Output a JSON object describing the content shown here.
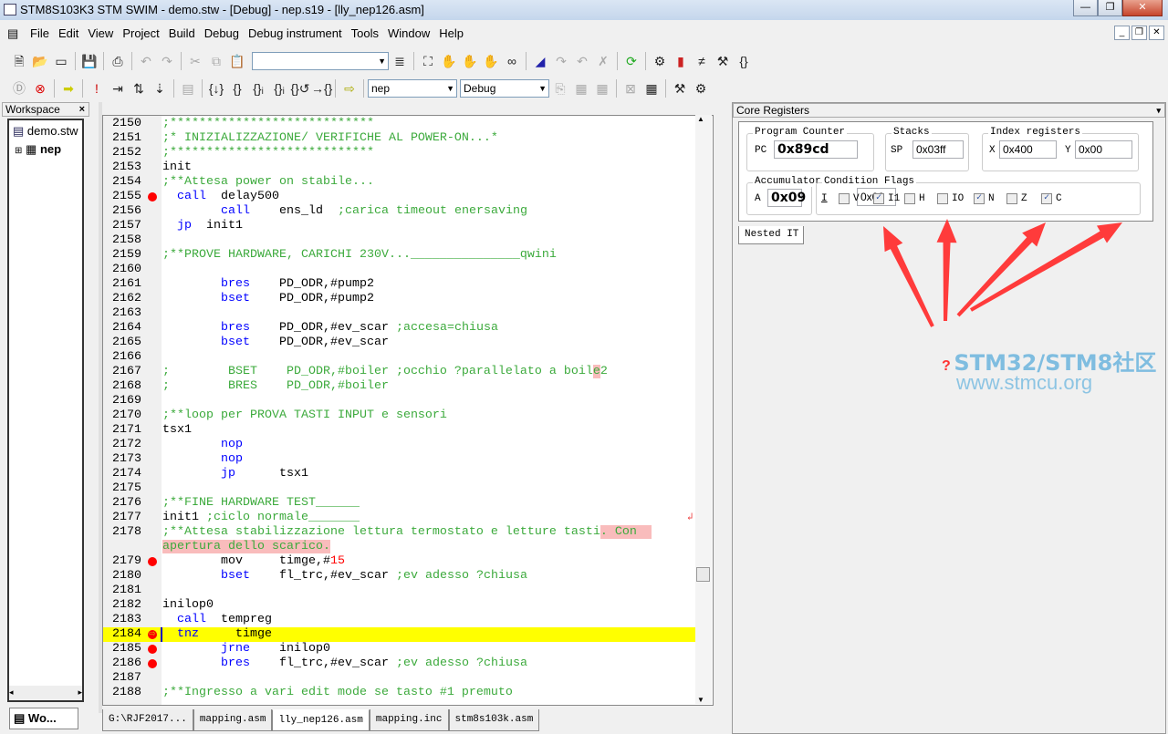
{
  "window": {
    "title": "STM8S103K3 STM SWIM - demo.stw - [Debug] - nep.s19 - [lly_nep126.asm]",
    "min": "—",
    "max": "❐",
    "close": "✕"
  },
  "menu": [
    "File",
    "Edit",
    "View",
    "Project",
    "Build",
    "Debug",
    "Debug instrument",
    "Tools",
    "Window",
    "Help"
  ],
  "toolbar1": {
    "search_value": ""
  },
  "toolbar2": {
    "project_combo": "nep",
    "config_combo": "Debug"
  },
  "workspace": {
    "title": "Workspace",
    "close": "×",
    "tree": [
      "demo.stw",
      "nep"
    ],
    "bottom_tab": "Wo..."
  },
  "editor": {
    "tabs": [
      "G:\\RJF2017...",
      "mapping.asm",
      "lly_nep126.asm",
      "mapping.inc",
      "stm8s103k.asm"
    ],
    "active_tab": 2,
    "lines": [
      {
        "n": "2150",
        "s": [
          [
            "cm",
            ";****************************"
          ]
        ]
      },
      {
        "n": "2151",
        "s": [
          [
            "cm",
            ";* INIZIALIZZAZIONE/ VERIFICHE AL POWER-ON...*"
          ]
        ]
      },
      {
        "n": "2152",
        "s": [
          [
            "cm",
            ";****************************"
          ]
        ]
      },
      {
        "n": "2153",
        "s": [
          [
            "tx",
            "init"
          ]
        ]
      },
      {
        "n": "2154",
        "s": [
          [
            "cm",
            ";**Attesa power on stabile..."
          ]
        ]
      },
      {
        "n": "2155",
        "bp": true,
        "s": [
          [
            "tx",
            "  "
          ],
          [
            "kw",
            "call"
          ],
          [
            "tx",
            "  delay500"
          ]
        ]
      },
      {
        "n": "2156",
        "s": [
          [
            "tx",
            "        "
          ],
          [
            "kw",
            "call"
          ],
          [
            "tx",
            "    ens_ld  "
          ],
          [
            "cm",
            ";carica timeout enersaving"
          ]
        ]
      },
      {
        "n": "2157",
        "s": [
          [
            "tx",
            "  "
          ],
          [
            "kw",
            "jp"
          ],
          [
            "tx",
            "  init1"
          ]
        ]
      },
      {
        "n": "2158",
        "s": []
      },
      {
        "n": "2159",
        "s": [
          [
            "cm",
            ";**PROVE HARDWARE, CARICHI 230V..._______________qwini"
          ]
        ]
      },
      {
        "n": "2160",
        "s": []
      },
      {
        "n": "2161",
        "s": [
          [
            "tx",
            "        "
          ],
          [
            "kw",
            "bres"
          ],
          [
            "tx",
            "    PD_ODR,#pump2"
          ]
        ]
      },
      {
        "n": "2162",
        "s": [
          [
            "tx",
            "        "
          ],
          [
            "kw",
            "bset"
          ],
          [
            "tx",
            "    PD_ODR,#pump2"
          ]
        ]
      },
      {
        "n": "2163",
        "s": []
      },
      {
        "n": "2164",
        "s": [
          [
            "tx",
            "        "
          ],
          [
            "kw",
            "bres"
          ],
          [
            "tx",
            "    PD_ODR,#ev_scar "
          ],
          [
            "cm",
            ";accesa=chiusa"
          ]
        ]
      },
      {
        "n": "2165",
        "s": [
          [
            "tx",
            "        "
          ],
          [
            "kw",
            "bset"
          ],
          [
            "tx",
            "    PD_ODR,#ev_scar"
          ]
        ]
      },
      {
        "n": "2166",
        "s": []
      },
      {
        "n": "2167",
        "s": [
          [
            "cm",
            ";        BSET    PD_ODR,#boiler ;occhio ?parallelato a boil"
          ],
          [
            "hl cm",
            "e"
          ],
          [
            "cm",
            "2"
          ]
        ]
      },
      {
        "n": "2168",
        "s": [
          [
            "cm",
            ";        BRES    PD_ODR,#boiler"
          ]
        ]
      },
      {
        "n": "2169",
        "s": []
      },
      {
        "n": "2170",
        "s": [
          [
            "cm",
            ";**loop per PROVA TASTI INPUT e sensori"
          ]
        ]
      },
      {
        "n": "2171",
        "s": [
          [
            "tx",
            "tsx1"
          ]
        ]
      },
      {
        "n": "2172",
        "s": [
          [
            "tx",
            "        "
          ],
          [
            "kw",
            "nop"
          ]
        ]
      },
      {
        "n": "2173",
        "s": [
          [
            "tx",
            "        "
          ],
          [
            "kw",
            "nop"
          ]
        ]
      },
      {
        "n": "2174",
        "s": [
          [
            "tx",
            "        "
          ],
          [
            "kw",
            "jp"
          ],
          [
            "tx",
            "      tsx1"
          ]
        ]
      },
      {
        "n": "2175",
        "s": []
      },
      {
        "n": "2176",
        "s": [
          [
            "cm",
            ";**FINE HARDWARE TEST______"
          ]
        ]
      },
      {
        "n": "2177",
        "s": [
          [
            "tx",
            "init1 "
          ],
          [
            "cm",
            ";ciclo normale_______"
          ]
        ]
      },
      {
        "n": "2178",
        "s": [
          [
            "cm",
            ";**Attesa stabilizzazione lettura termostato e letture tasti"
          ],
          [
            "hl cm",
            ". Con  "
          ]
        ]
      },
      {
        "n": "",
        "s": [
          [
            "hl cm",
            "apertura dello scarico."
          ]
        ]
      },
      {
        "n": "2179",
        "bp": true,
        "s": [
          [
            "tx",
            "        mov     timge,#"
          ],
          [
            "nm",
            "15"
          ]
        ]
      },
      {
        "n": "2180",
        "s": [
          [
            "tx",
            "        "
          ],
          [
            "kw",
            "bset"
          ],
          [
            "tx",
            "    fl_trc,#ev_scar "
          ],
          [
            "cm",
            ";ev adesso ?chiusa"
          ]
        ]
      },
      {
        "n": "2181",
        "s": []
      },
      {
        "n": "2182",
        "s": [
          [
            "tx",
            "inilop0"
          ]
        ]
      },
      {
        "n": "2183",
        "s": [
          [
            "tx",
            "  "
          ],
          [
            "kw",
            "call"
          ],
          [
            "tx",
            "  tempreg"
          ]
        ]
      },
      {
        "n": "2184",
        "bp": true,
        "cur": true,
        "s": [
          [
            "tx",
            "  "
          ],
          [
            "kw",
            "tnz"
          ],
          [
            "tx",
            "     timge"
          ]
        ]
      },
      {
        "n": "2185",
        "bp": true,
        "s": [
          [
            "tx",
            "        "
          ],
          [
            "kw",
            "jrne"
          ],
          [
            "tx",
            "    inilop0"
          ]
        ]
      },
      {
        "n": "2186",
        "bp": true,
        "s": [
          [
            "tx",
            "        "
          ],
          [
            "kw",
            "bres"
          ],
          [
            "tx",
            "    fl_trc,#ev_scar "
          ],
          [
            "cm",
            ";ev adesso ?chiusa"
          ]
        ]
      },
      {
        "n": "2187",
        "s": []
      },
      {
        "n": "2188",
        "s": [
          [
            "cm",
            ";**Ingresso a vari edit mode se tasto #1 premuto"
          ]
        ]
      }
    ]
  },
  "core": {
    "title": "Core Registers",
    "close": "×",
    "pc_group": "Program Counter",
    "pc_label": "PC",
    "pc": "0x89cd",
    "stacks_group": "Stacks",
    "sp_label": "SP",
    "sp": "0x03ff",
    "index_group": "Index registers",
    "x_label": "X",
    "x": "0x400",
    "y_label": "Y",
    "y": "0x00",
    "acc_group": "Accumulator",
    "a_label": "A",
    "a": "0x09",
    "flags_group": "Condition Flags",
    "i_label": "I",
    "flags_value": "0x00",
    "flags": [
      {
        "name": "V",
        "checked": false
      },
      {
        "name": "I1",
        "checked": true
      },
      {
        "name": "H",
        "checked": false
      },
      {
        "name": "IO",
        "checked": false
      },
      {
        "name": "N",
        "checked": true
      },
      {
        "name": "Z",
        "checked": false
      },
      {
        "name": "C",
        "checked": true
      }
    ],
    "tab": "Nested IT"
  },
  "annotation_color": "#ff3b3b",
  "watermark": {
    "line1": "STM32/STM8社区",
    "line2": "www.stmcu.org",
    "mark": "?",
    "color": "#7fbde0"
  }
}
